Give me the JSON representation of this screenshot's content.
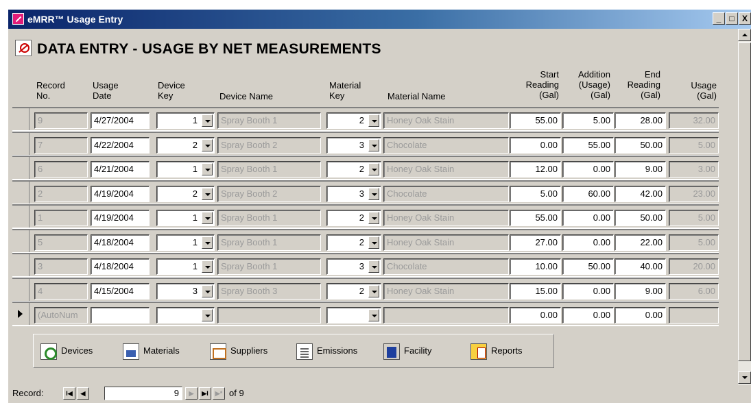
{
  "window": {
    "title": "eMRR™ Usage Entry",
    "minimize": "_",
    "restore": "□",
    "close": "X"
  },
  "form": {
    "heading": "DATA ENTRY - USAGE BY NET MEASUREMENTS"
  },
  "columns": {
    "record_no": [
      "Record",
      "No."
    ],
    "usage_date": [
      "Usage",
      "Date"
    ],
    "device_key": [
      "Device",
      "Key"
    ],
    "device_name": "Device Name",
    "material_key": [
      "Material",
      "Key"
    ],
    "material_name": "Material Name",
    "start_reading": [
      "Start",
      "Reading",
      "(Gal)"
    ],
    "addition": [
      "Addition",
      "(Usage)",
      "(Gal)"
    ],
    "end_reading": [
      "End",
      "Reading",
      "(Gal)"
    ],
    "usage": [
      "Usage",
      "(Gal)"
    ]
  },
  "rows": [
    {
      "record": "9",
      "date": "4/27/2004",
      "device_key": "1",
      "device_name": "Spray Booth 1",
      "material_key": "2",
      "material_name": "Honey Oak Stain",
      "start": "55.00",
      "addition": "5.00",
      "end": "28.00",
      "usage": "32.00"
    },
    {
      "record": "7",
      "date": "4/22/2004",
      "device_key": "2",
      "device_name": "Spray Booth 2",
      "material_key": "3",
      "material_name": "Chocolate",
      "start": "0.00",
      "addition": "55.00",
      "end": "50.00",
      "usage": "5.00"
    },
    {
      "record": "6",
      "date": "4/21/2004",
      "device_key": "1",
      "device_name": "Spray Booth 1",
      "material_key": "2",
      "material_name": "Honey Oak Stain",
      "start": "12.00",
      "addition": "0.00",
      "end": "9.00",
      "usage": "3.00"
    },
    {
      "record": "2",
      "date": "4/19/2004",
      "device_key": "2",
      "device_name": "Spray Booth 2",
      "material_key": "3",
      "material_name": "Chocolate",
      "start": "5.00",
      "addition": "60.00",
      "end": "42.00",
      "usage": "23.00"
    },
    {
      "record": "1",
      "date": "4/19/2004",
      "device_key": "1",
      "device_name": "Spray Booth 1",
      "material_key": "2",
      "material_name": "Honey Oak Stain",
      "start": "55.00",
      "addition": "0.00",
      "end": "50.00",
      "usage": "5.00"
    },
    {
      "record": "5",
      "date": "4/18/2004",
      "device_key": "1",
      "device_name": "Spray Booth 1",
      "material_key": "2",
      "material_name": "Honey Oak Stain",
      "start": "27.00",
      "addition": "0.00",
      "end": "22.00",
      "usage": "5.00"
    },
    {
      "record": "3",
      "date": "4/18/2004",
      "device_key": "1",
      "device_name": "Spray Booth 1",
      "material_key": "3",
      "material_name": "Chocolate",
      "start": "10.00",
      "addition": "50.00",
      "end": "40.00",
      "usage": "20.00"
    },
    {
      "record": "4",
      "date": "4/15/2004",
      "device_key": "3",
      "device_name": "Spray Booth 3",
      "material_key": "2",
      "material_name": "Honey Oak Stain",
      "start": "15.00",
      "addition": "0.00",
      "end": "9.00",
      "usage": "6.00"
    }
  ],
  "new_row": {
    "record": "(AutoNum",
    "date": "",
    "device_key": "",
    "device_name": "",
    "material_key": "",
    "material_name": "",
    "start": "0.00",
    "addition": "0.00",
    "end": "0.00",
    "usage": ""
  },
  "nav_buttons": [
    {
      "label": "Devices",
      "icon": "devices-icon"
    },
    {
      "label": "Materials",
      "icon": "materials-icon"
    },
    {
      "label": "Suppliers",
      "icon": "suppliers-icon"
    },
    {
      "label": "Emissions",
      "icon": "emissions-icon"
    },
    {
      "label": "Facility",
      "icon": "facility-icon"
    },
    {
      "label": "Reports",
      "icon": "reports-icon"
    }
  ],
  "record_nav": {
    "label": "Record:",
    "current": "9",
    "of_label": "of 9",
    "first": "I◀",
    "prev": "◀",
    "next": "▶",
    "last": "▶I",
    "new": "▶*"
  }
}
